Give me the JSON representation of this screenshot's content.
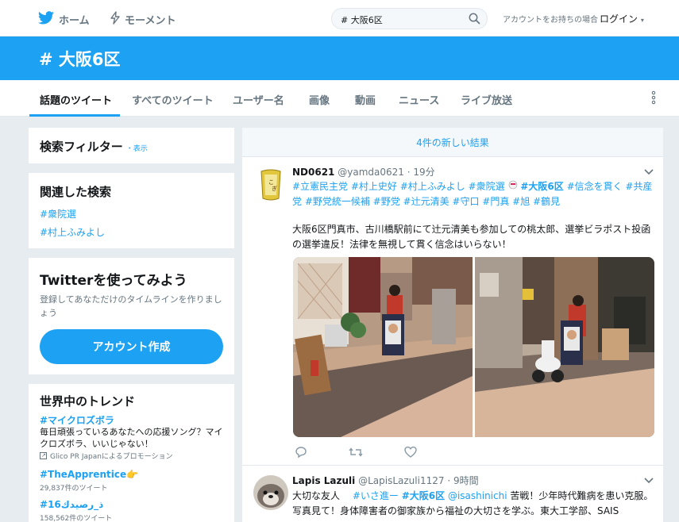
{
  "nav": {
    "home": "ホーム",
    "moments": "モーメント",
    "search_value": "# 大阪6区",
    "account_question": "アカウントをお持ちの場合",
    "login": "ログイン"
  },
  "banner": {
    "title": "# 大阪6区"
  },
  "tabs": [
    {
      "label": "話題のツイート"
    },
    {
      "label": "すべてのツイート"
    },
    {
      "label": "ユーザー名"
    },
    {
      "label": "画像"
    },
    {
      "label": "動画"
    },
    {
      "label": "ニュース"
    },
    {
      "label": "ライブ放送"
    }
  ],
  "filters": {
    "title": "検索フィルター",
    "show": "・表示"
  },
  "related": {
    "title": "関連した検索",
    "items": [
      "#衆院選",
      "#村上ふみよし"
    ]
  },
  "signup_card": {
    "title": "Twitterを使ってみよう",
    "desc": "登録してあなただけのタイムラインを作りましょう",
    "button": "アカウント作成"
  },
  "trends": {
    "title": "世界中のトレンド",
    "items": [
      {
        "name": "#マイクロズボラ",
        "desc": "毎日頑張っているあなたへの応援ソング？マイクロズボラ、いいじゃない！",
        "promo": "Glico PR Japanによるプロモーション"
      },
      {
        "name": "#TheApprentice👉",
        "count": "29,837件のツイート"
      },
      {
        "name": "#ذ_رصيدك16",
        "count": "158,562件のツイート"
      }
    ]
  },
  "timeline": {
    "new_results": "4件の新しい結果",
    "tweets": [
      {
        "name": "ND0621",
        "handle": "@yamda0621",
        "time": "· 19分",
        "tags_line1": "#立憲民主党 #村上史好 #村上ふみよし #衆院選",
        "tags_bold": "#大阪6区",
        "tags_line1b": "#信念を貫く #共産",
        "tags_line2": "党 #野党統一候補 #野党 #辻元清美 #守口 #門真 #旭 #鶴見",
        "body": "大阪6区門真市、古川橋駅前にて辻元清美も参加しての桃太郎、選挙ビラポスト投函の選挙違反！法律を無視して貫く信念はいらない！"
      },
      {
        "name": "Lapis Lazuli",
        "handle": "@LapisLazuli1127",
        "time": "· 9時間",
        "body_start": "大切な友人　",
        "body_link1": "#いさ進ー",
        "body_link2": "#大阪6区",
        "body_link3": "@isashinichi",
        "body_rest": " 苦戦！少年時代難病を患い克服。写真見て！身体障害者の御家族から福祉の大切さを学ぶ。東大工学部、SAIS"
      }
    ]
  },
  "colors": {
    "accent": "#1da1f2",
    "background": "#e6ecf0",
    "text": "#14171a",
    "muted": "#66757f"
  }
}
